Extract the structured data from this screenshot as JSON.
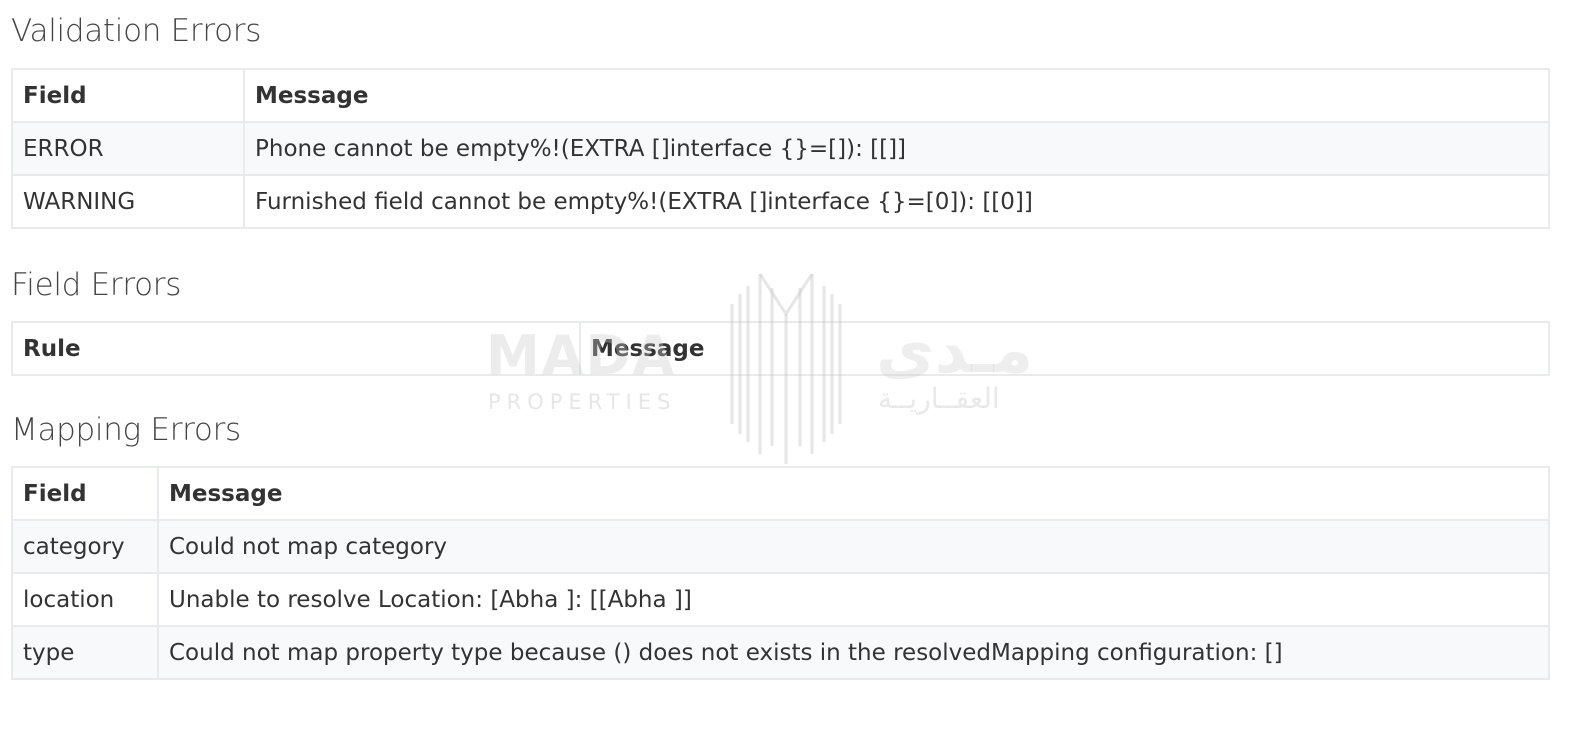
{
  "sections": {
    "validation": {
      "title": "Validation Errors",
      "headers": [
        "Field",
        "Message"
      ],
      "rows": [
        {
          "field": "ERROR",
          "message": "Phone cannot be empty%!(EXTRA []interface {}=[]): [[]]"
        },
        {
          "field": "WARNING",
          "message": "Furnished field cannot be empty%!(EXTRA []interface {}=[0]): [[0]]"
        }
      ]
    },
    "field": {
      "title": "Field Errors",
      "headers": [
        "Rule",
        "Message"
      ],
      "rows": []
    },
    "mapping": {
      "title": "Mapping Errors",
      "headers": [
        "Field",
        "Message"
      ],
      "rows": [
        {
          "field": "category",
          "message": "Could not map category"
        },
        {
          "field": "location",
          "message": "Unable to resolve Location: [Abha ]: [[Abha ]]"
        },
        {
          "field": "type",
          "message": "Could not map property type because () does not exists in the resolvedMapping configuration: []"
        }
      ]
    }
  },
  "watermark": {
    "latin": "MADA",
    "sub": "PROPERTIES",
    "arabic": "مـدى",
    "arabic_sub": "العقــاريــة"
  },
  "colors": {
    "border": "#e8eaed",
    "row_alt": "#f8f9fb",
    "text": "#333333"
  }
}
